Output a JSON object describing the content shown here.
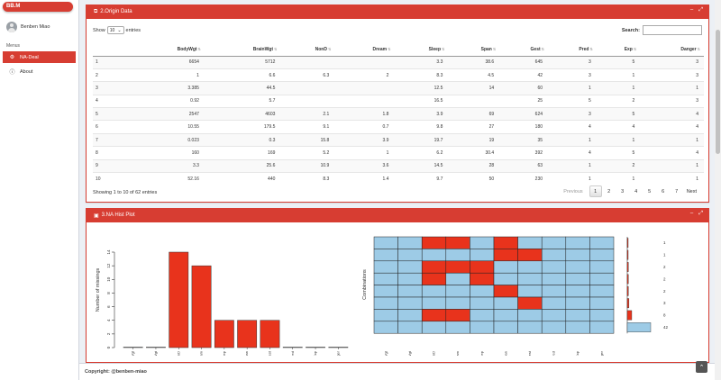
{
  "app": {
    "logo": "BB.M"
  },
  "user": {
    "name": "Benben Miao"
  },
  "sidebar": {
    "heading": "Menus",
    "items": [
      {
        "label": "NA-Deal",
        "icon": "gear-icon",
        "active": true
      },
      {
        "label": "About",
        "icon": "info-icon",
        "active": false
      }
    ]
  },
  "data_box": {
    "title": "2.Origin Data",
    "show_label": "Show",
    "entries_value": "10",
    "entries_label": "entries",
    "search_label": "Search:",
    "search_value": "",
    "columns": [
      "",
      "BodyWgt",
      "BrainWgt",
      "NonD",
      "Dream",
      "Sleep",
      "Span",
      "Gest",
      "Pred",
      "Exp",
      "Danger"
    ],
    "rows": [
      [
        "1",
        "6654",
        "5712",
        "",
        "",
        "3.3",
        "38.6",
        "645",
        "3",
        "5",
        "3"
      ],
      [
        "2",
        "1",
        "6.6",
        "6.3",
        "2",
        "8.3",
        "4.5",
        "42",
        "3",
        "1",
        "3"
      ],
      [
        "3",
        "3.385",
        "44.5",
        "",
        "",
        "12.5",
        "14",
        "60",
        "1",
        "1",
        "1"
      ],
      [
        "4",
        "0.92",
        "5.7",
        "",
        "",
        "16.5",
        "",
        "25",
        "5",
        "2",
        "3"
      ],
      [
        "5",
        "2547",
        "4603",
        "2.1",
        "1.8",
        "3.9",
        "69",
        "624",
        "3",
        "5",
        "4"
      ],
      [
        "6",
        "10.55",
        "179.5",
        "9.1",
        "0.7",
        "9.8",
        "27",
        "180",
        "4",
        "4",
        "4"
      ],
      [
        "7",
        "0.023",
        "0.3",
        "15.8",
        "3.9",
        "19.7",
        "19",
        "35",
        "1",
        "1",
        "1"
      ],
      [
        "8",
        "160",
        "169",
        "5.2",
        "1",
        "6.2",
        "30.4",
        "392",
        "4",
        "5",
        "4"
      ],
      [
        "9",
        "3.3",
        "25.6",
        "10.9",
        "3.6",
        "14.5",
        "28",
        "63",
        "1",
        "2",
        "1"
      ],
      [
        "10",
        "52.16",
        "440",
        "8.3",
        "1.4",
        "9.7",
        "50",
        "230",
        "1",
        "1",
        "1"
      ]
    ],
    "info": "Showing 1 to 10 of 62 entries",
    "pagination": {
      "previous": "Previous",
      "pages": [
        "1",
        "2",
        "3",
        "4",
        "5",
        "6",
        "7"
      ],
      "current": "1",
      "next": "Next"
    }
  },
  "plot_box": {
    "title": "3.NA Hist Plot"
  },
  "footer": {
    "text": "Copyright: @benben-miao"
  },
  "colors": {
    "accent": "#d73d32",
    "missing": "#e8331c",
    "present": "#9dcbe6"
  },
  "chart_data": [
    {
      "type": "bar",
      "categories": [
        "BodyWgt",
        "BrainWgt",
        "NonD",
        "Dream",
        "Sleep",
        "Span",
        "Gest",
        "Pred",
        "Exp",
        "Danger"
      ],
      "values": [
        0,
        0,
        14,
        12,
        4,
        4,
        4,
        0,
        0,
        0
      ],
      "ylabel": "Number of missings",
      "ylim": [
        0,
        14
      ],
      "yticks": [
        "0",
        "2",
        "4",
        "6",
        "8",
        "10",
        "12",
        "14"
      ]
    },
    {
      "type": "heatmap",
      "columns": [
        "BodyWgt",
        "BrainWgt",
        "NonD",
        "Dream",
        "Sleep",
        "Span",
        "Gest",
        "Pred",
        "Exp",
        "Danger"
      ],
      "ylabel": "Combinations",
      "rows": [
        {
          "missing": [
            0,
            0,
            1,
            1,
            0,
            1,
            0,
            0,
            0,
            0
          ],
          "count": 1
        },
        {
          "missing": [
            0,
            0,
            0,
            0,
            0,
            1,
            1,
            0,
            0,
            0
          ],
          "count": 1
        },
        {
          "missing": [
            0,
            0,
            1,
            1,
            1,
            0,
            0,
            0,
            0,
            0
          ],
          "count": 2
        },
        {
          "missing": [
            0,
            0,
            1,
            0,
            1,
            0,
            0,
            0,
            0,
            0
          ],
          "count": 2
        },
        {
          "missing": [
            0,
            0,
            0,
            0,
            0,
            1,
            0,
            0,
            0,
            0
          ],
          "count": 2
        },
        {
          "missing": [
            0,
            0,
            0,
            0,
            0,
            0,
            1,
            0,
            0,
            0
          ],
          "count": 3
        },
        {
          "missing": [
            0,
            0,
            1,
            1,
            0,
            0,
            0,
            0,
            0,
            0
          ],
          "count": 8
        },
        {
          "missing": [
            0,
            0,
            0,
            0,
            0,
            0,
            0,
            0,
            0,
            0
          ],
          "count": 42
        }
      ]
    }
  ]
}
